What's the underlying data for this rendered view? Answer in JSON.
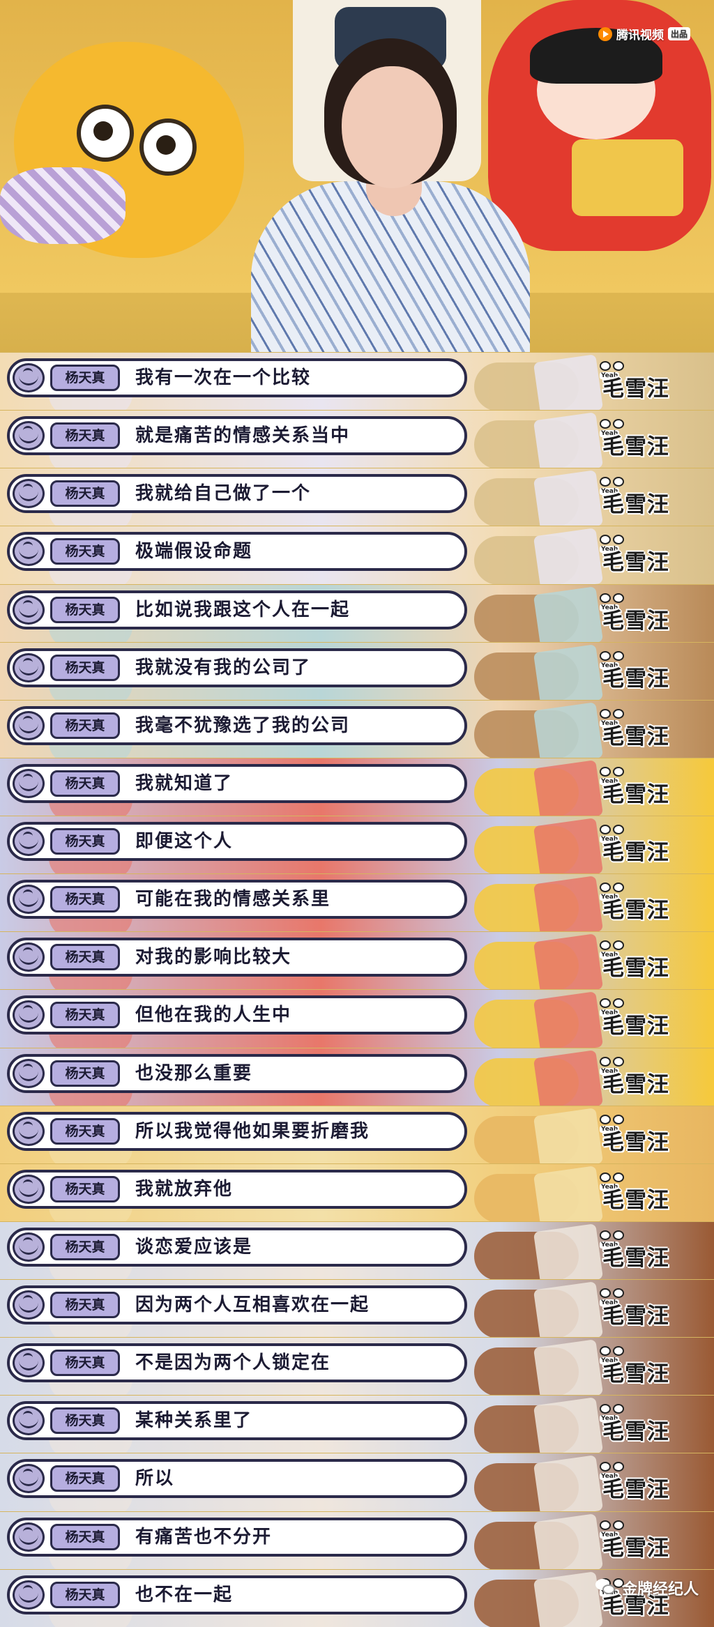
{
  "video": {
    "watermark": "腾讯视频",
    "watermark_badge": "出品",
    "show_logo": "毛雪汪",
    "show_logo_tag": "Yeah"
  },
  "speaker": "杨天真",
  "captions": [
    "我有一次在一个比较",
    "就是痛苦的情感关系当中",
    "我就给自己做了一个",
    "极端假设命题",
    "比如说我跟这个人在一起",
    "我就没有我的公司了",
    "我毫不犹豫选了我的公司",
    "我就知道了",
    "即便这个人",
    "可能在我的情感关系里",
    "对我的影响比较大",
    "但他在我的人生中",
    "也没那么重要",
    "所以我觉得他如果要折磨我",
    "我就放弃他",
    "谈恋爱应该是",
    "因为两个人互相喜欢在一起",
    "不是因为两个人锁定在",
    "某种关系里了",
    "所以",
    "有痛苦也不分开",
    "也不在一起"
  ],
  "footer": {
    "account": "金牌经纪人"
  },
  "colors": {
    "caption_border": "#2b2a4a",
    "name_badge": "#b6aee0",
    "sofa": "#e9c566"
  }
}
